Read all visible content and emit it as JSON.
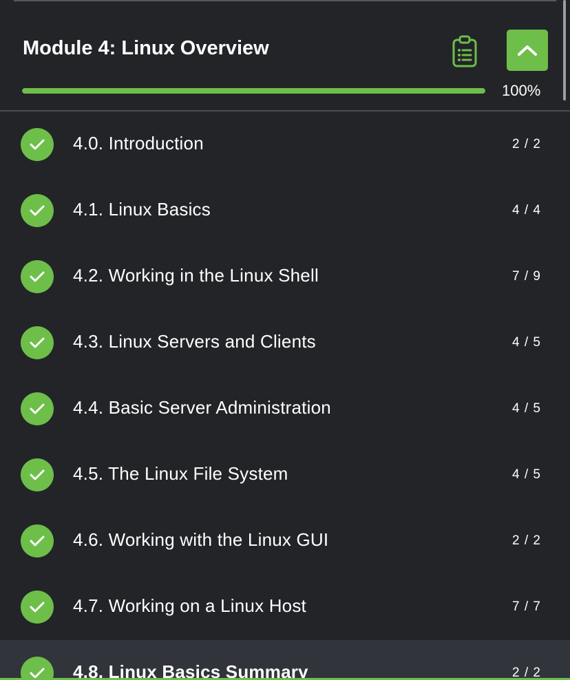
{
  "module": {
    "title": "Module 4: Linux Overview",
    "progress_label": "100%",
    "progress_fraction": 1.0,
    "icons": {
      "clipboard": "clipboard-list-icon",
      "collapse": "chevron-up-icon"
    }
  },
  "colors": {
    "background": "#232428",
    "accent": "#6ebe4a",
    "active_row": "#31343a"
  },
  "items": [
    {
      "title": "4.0. Introduction",
      "count": "2 / 2",
      "completed": true
    },
    {
      "title": "4.1. Linux Basics",
      "count": "4 / 4",
      "completed": true
    },
    {
      "title": "4.2. Working in the Linux Shell",
      "count": "7 / 9",
      "completed": true
    },
    {
      "title": "4.3. Linux Servers and Clients",
      "count": "4 / 5",
      "completed": true
    },
    {
      "title": "4.4. Basic Server Administration",
      "count": "4 / 5",
      "completed": true
    },
    {
      "title": "4.5. The Linux File System",
      "count": "4 / 5",
      "completed": true
    },
    {
      "title": "4.6. Working with the Linux GUI",
      "count": "2 / 2",
      "completed": true
    },
    {
      "title": "4.7. Working on a Linux Host",
      "count": "7 / 7",
      "completed": true
    },
    {
      "title": "4.8. Linux Basics Summary",
      "count": "2 / 2",
      "completed": true,
      "active": true
    }
  ]
}
